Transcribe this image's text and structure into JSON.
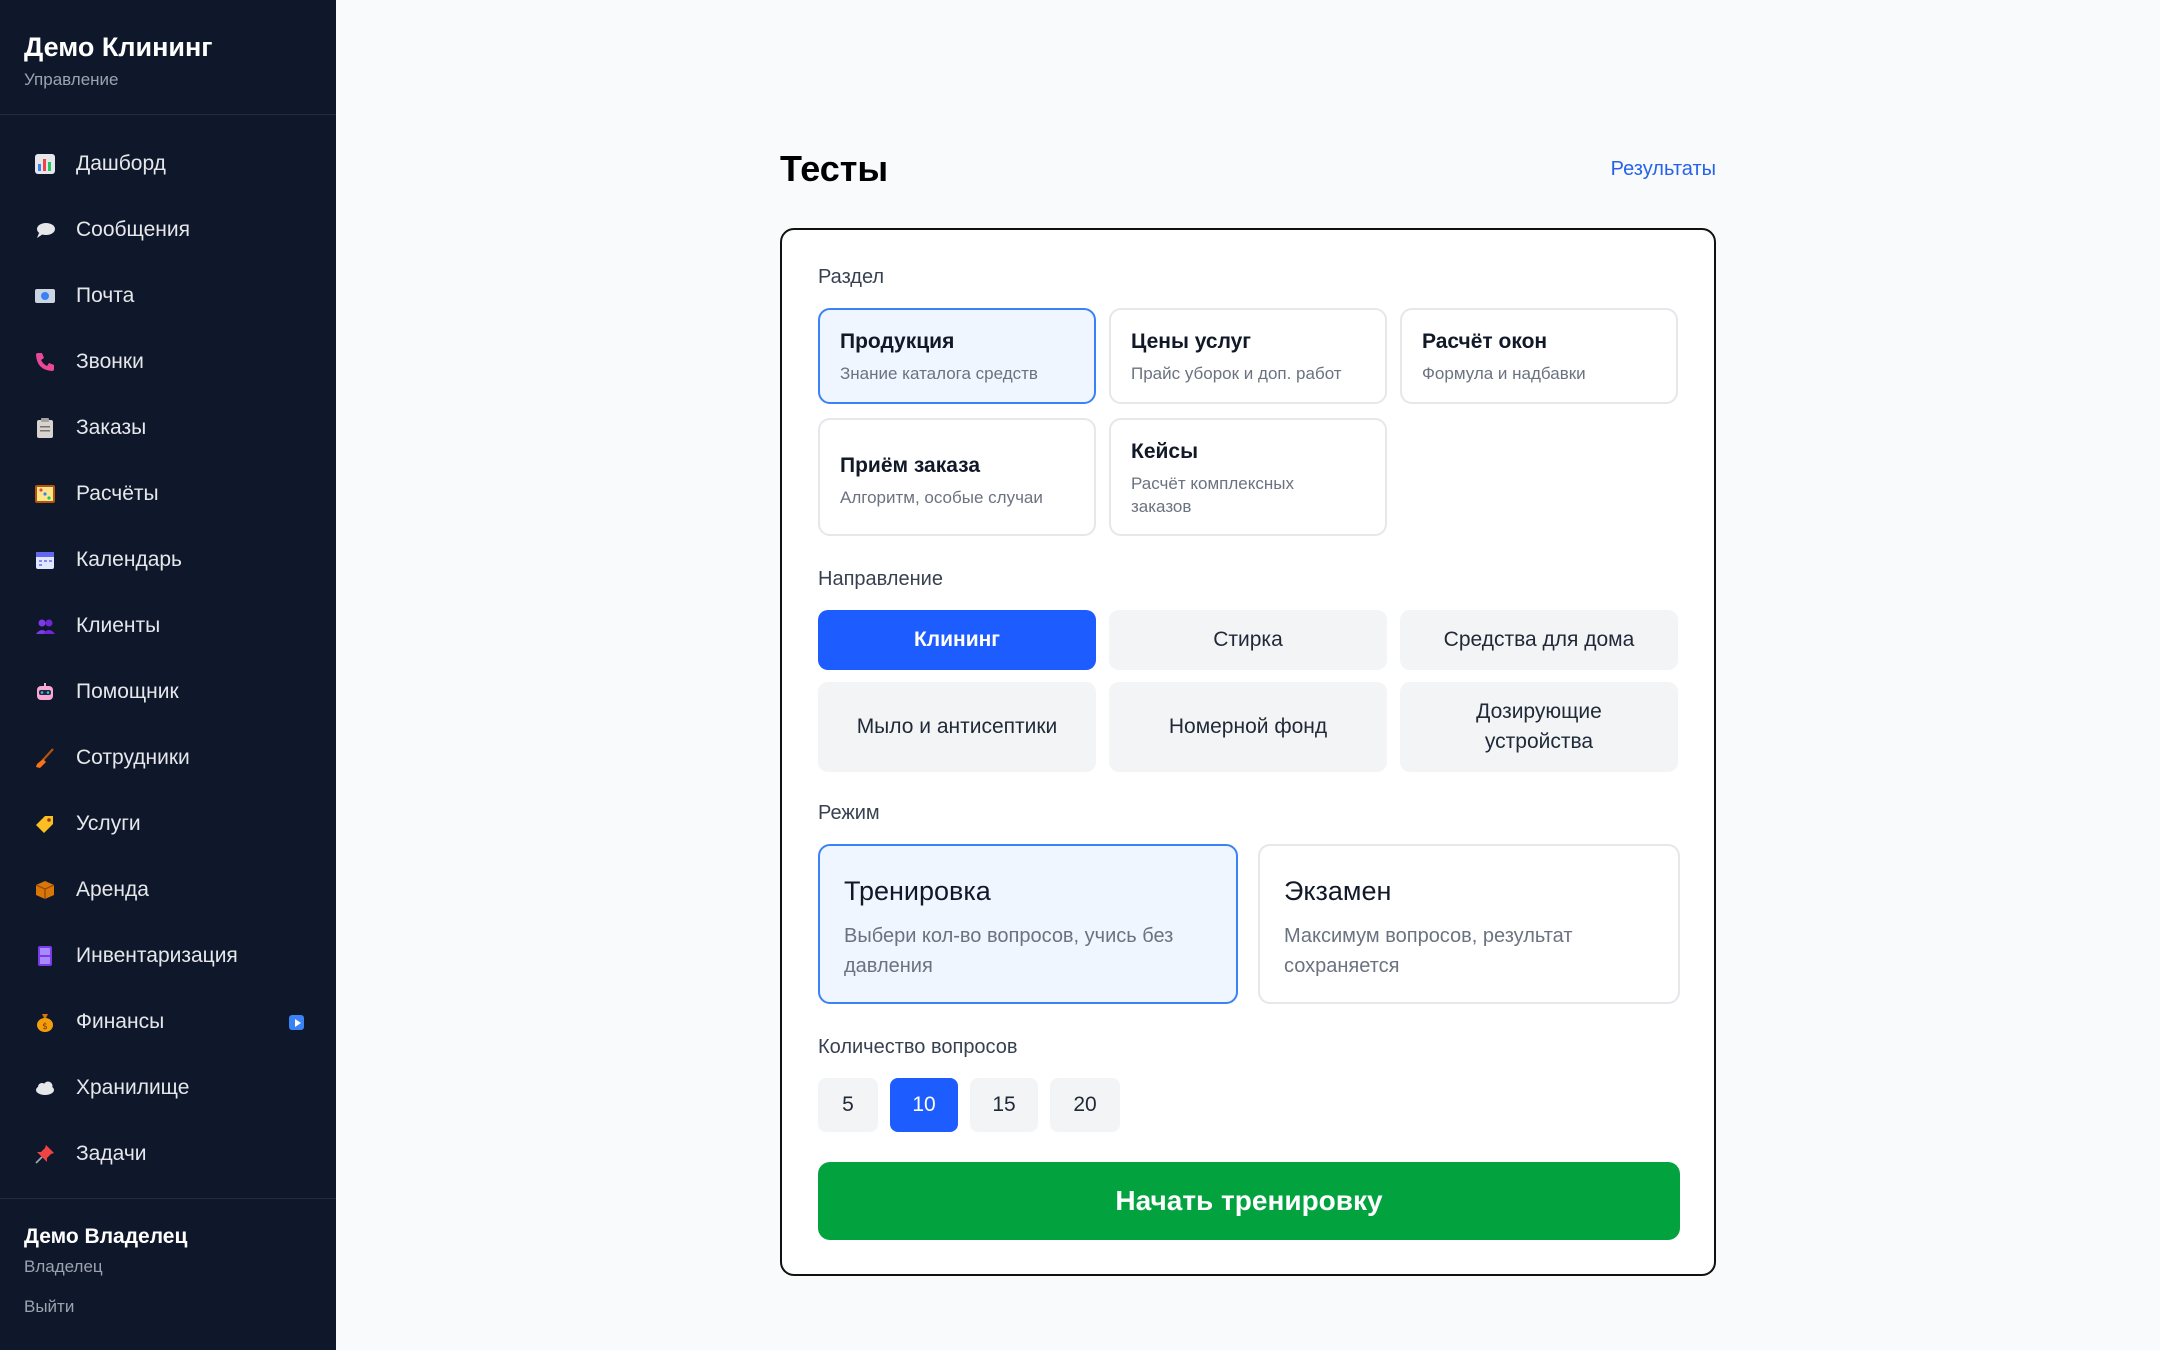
{
  "app": {
    "brand_title": "Демо Клининг",
    "brand_subtitle": "Управление"
  },
  "sidebar": {
    "items": [
      {
        "label": "Дашборд",
        "icon": "chart-icon"
      },
      {
        "label": "Сообщения",
        "icon": "speech-bubble-icon"
      },
      {
        "label": "Почта",
        "icon": "mail-icon"
      },
      {
        "label": "Звонки",
        "icon": "phone-icon"
      },
      {
        "label": "Заказы",
        "icon": "clipboard-icon"
      },
      {
        "label": "Расчёты",
        "icon": "abacus-icon"
      },
      {
        "label": "Календарь",
        "icon": "calendar-icon"
      },
      {
        "label": "Клиенты",
        "icon": "users-icon"
      },
      {
        "label": "Помощник",
        "icon": "robot-icon"
      },
      {
        "label": "Сотрудники",
        "icon": "broom-icon"
      },
      {
        "label": "Услуги",
        "icon": "tag-icon"
      },
      {
        "label": "Аренда",
        "icon": "box-icon"
      },
      {
        "label": "Инвентаризация",
        "icon": "cabinet-icon"
      },
      {
        "label": "Финансы",
        "icon": "money-bag-icon",
        "badge": "play-badge-icon"
      },
      {
        "label": "Хранилище",
        "icon": "cloud-icon"
      },
      {
        "label": "Задачи",
        "icon": "pin-icon"
      }
    ],
    "user": {
      "name": "Демо Владелец",
      "role": "Владелец",
      "logout": "Выйти"
    }
  },
  "page": {
    "title": "Тесты",
    "results_link": "Результаты"
  },
  "form": {
    "section_label": "Раздел",
    "sections": [
      {
        "title": "Продукция",
        "desc": "Знание каталога средств",
        "selected": true
      },
      {
        "title": "Цены услуг",
        "desc": "Прайс уборок и доп. работ",
        "selected": false
      },
      {
        "title": "Расчёт окон",
        "desc": "Формула и надбавки",
        "selected": false
      },
      {
        "title": "Приём заказа",
        "desc": "Алгоритм, особые случаи",
        "selected": false
      },
      {
        "title": "Кейсы",
        "desc": "Расчёт комплексных заказов",
        "selected": false
      }
    ],
    "direction_label": "Направление",
    "directions": [
      {
        "label": "Клининг",
        "selected": true
      },
      {
        "label": "Стирка",
        "selected": false
      },
      {
        "label": "Средства для дома",
        "selected": false
      },
      {
        "label": "Мыло и антисептики",
        "selected": false
      },
      {
        "label": "Номерной фонд",
        "selected": false
      },
      {
        "label": "Дозирующие устройства",
        "selected": false
      }
    ],
    "mode_label": "Режим",
    "modes": [
      {
        "title": "Тренировка",
        "desc": "Выбери кол-во вопросов, учись без давления",
        "selected": true
      },
      {
        "title": "Экзамен",
        "desc": "Максимум вопросов, результат сохраняется",
        "selected": false
      }
    ],
    "count_label": "Количество вопросов",
    "counts": [
      {
        "label": "5",
        "selected": false
      },
      {
        "label": "10",
        "selected": true
      },
      {
        "label": "15",
        "selected": false
      },
      {
        "label": "20",
        "selected": false
      }
    ],
    "start_button": "Начать тренировку"
  },
  "colors": {
    "sidebar_bg": "#0f172a",
    "accent": "#1d5cff",
    "selected_border": "#3b82f6",
    "start_button": "#02a33f"
  }
}
